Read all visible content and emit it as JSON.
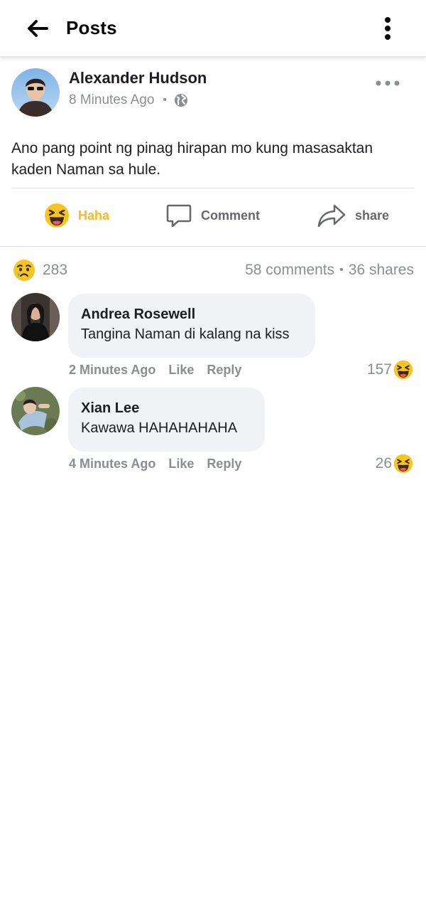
{
  "header": {
    "title": "Posts",
    "back_icon": "arrow-left-icon",
    "menu_icon": "kebab-menu-icon"
  },
  "post": {
    "author": "Alexander Hudson",
    "time": "8 Minutes Ago",
    "separator": "•",
    "privacy_icon": "globe-icon",
    "more_icon": "more-horizontal-icon",
    "text": "Ano pang point ng pinag hirapan mo kung masasaktan kaden Naman sa hule.",
    "actions": {
      "haha_label": "Haha",
      "comment_label": "Comment",
      "share_label": "share"
    },
    "reaction_count": "283",
    "reaction_icon": "sad-face-icon",
    "comments_label": "58 comments",
    "shares_label": "36 shares"
  },
  "comments": [
    {
      "name": "Andrea Rosewell",
      "text": "Tangina Naman di kalang na kiss",
      "time": "2 Minutes Ago",
      "like_label": "Like",
      "reply_label": "Reply",
      "reaction_count": "157",
      "reaction_icon": "haha-face-icon"
    },
    {
      "name": "Xian Lee",
      "text": "Kawawa HAHAHAHAHA",
      "time": "4 Minutes Ago",
      "like_label": "Like",
      "reply_label": "Reply",
      "reaction_count": "26",
      "reaction_icon": "haha-face-icon"
    }
  ],
  "colors": {
    "haha_accent": "#f7b928",
    "muted_text": "#8a8d91",
    "bubble_bg": "#f0f2f5"
  }
}
